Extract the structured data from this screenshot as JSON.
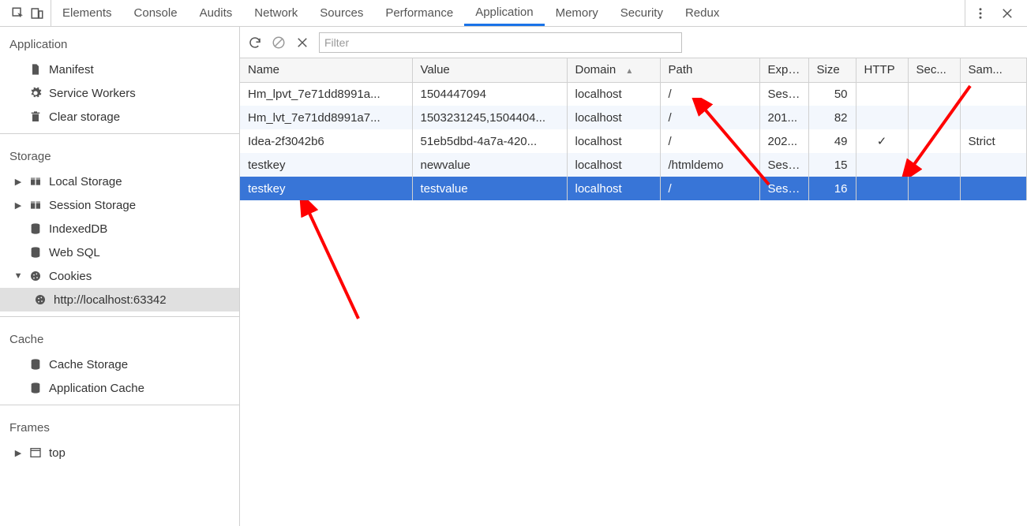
{
  "tabs": {
    "items": [
      {
        "id": "elements",
        "label": "Elements"
      },
      {
        "id": "console",
        "label": "Console"
      },
      {
        "id": "audits",
        "label": "Audits"
      },
      {
        "id": "network",
        "label": "Network"
      },
      {
        "id": "sources",
        "label": "Sources"
      },
      {
        "id": "performance",
        "label": "Performance"
      },
      {
        "id": "application",
        "label": "Application"
      },
      {
        "id": "memory",
        "label": "Memory"
      },
      {
        "id": "security",
        "label": "Security"
      },
      {
        "id": "redux",
        "label": "Redux"
      }
    ],
    "active": "application"
  },
  "sidebar": {
    "application": {
      "header": "Application",
      "manifest": "Manifest",
      "service_workers": "Service Workers",
      "clear_storage": "Clear storage"
    },
    "storage": {
      "header": "Storage",
      "local_storage": "Local Storage",
      "session_storage": "Session Storage",
      "indexeddb": "IndexedDB",
      "websql": "Web SQL",
      "cookies": "Cookies",
      "cookies_origin": "http://localhost:63342"
    },
    "cache": {
      "header": "Cache",
      "cache_storage": "Cache Storage",
      "application_cache": "Application Cache"
    },
    "frames": {
      "header": "Frames",
      "top": "top"
    }
  },
  "toolbar": {
    "filter_placeholder": "Filter"
  },
  "columns": {
    "name": "Name",
    "value": "Value",
    "domain": "Domain",
    "path": "Path",
    "expires": "Expi...",
    "size": "Size",
    "http": "HTTP",
    "secure": "Sec...",
    "samesite": "Sam..."
  },
  "rows": [
    {
      "name": "Hm_lpvt_7e71dd8991a...",
      "value": "1504447094",
      "domain": "localhost",
      "path": "/",
      "expires": "Sess...",
      "size": "50",
      "http": "",
      "secure": "",
      "same": ""
    },
    {
      "name": "Hm_lvt_7e71dd8991a7...",
      "value": "1503231245,1504404...",
      "domain": "localhost",
      "path": "/",
      "expires": "201...",
      "size": "82",
      "http": "",
      "secure": "",
      "same": ""
    },
    {
      "name": "Idea-2f3042b6",
      "value": "51eb5dbd-4a7a-420...",
      "domain": "localhost",
      "path": "/",
      "expires": "202...",
      "size": "49",
      "http": "✓",
      "secure": "",
      "same": "Strict"
    },
    {
      "name": "testkey",
      "value": "newvalue",
      "domain": "localhost",
      "path": "/htmldemo",
      "expires": "Sess...",
      "size": "15",
      "http": "",
      "secure": "",
      "same": ""
    },
    {
      "name": "testkey",
      "value": "testvalue",
      "domain": "localhost",
      "path": "/",
      "expires": "Sess...",
      "size": "16",
      "http": "",
      "secure": "",
      "same": ""
    }
  ],
  "selected_row": 4
}
